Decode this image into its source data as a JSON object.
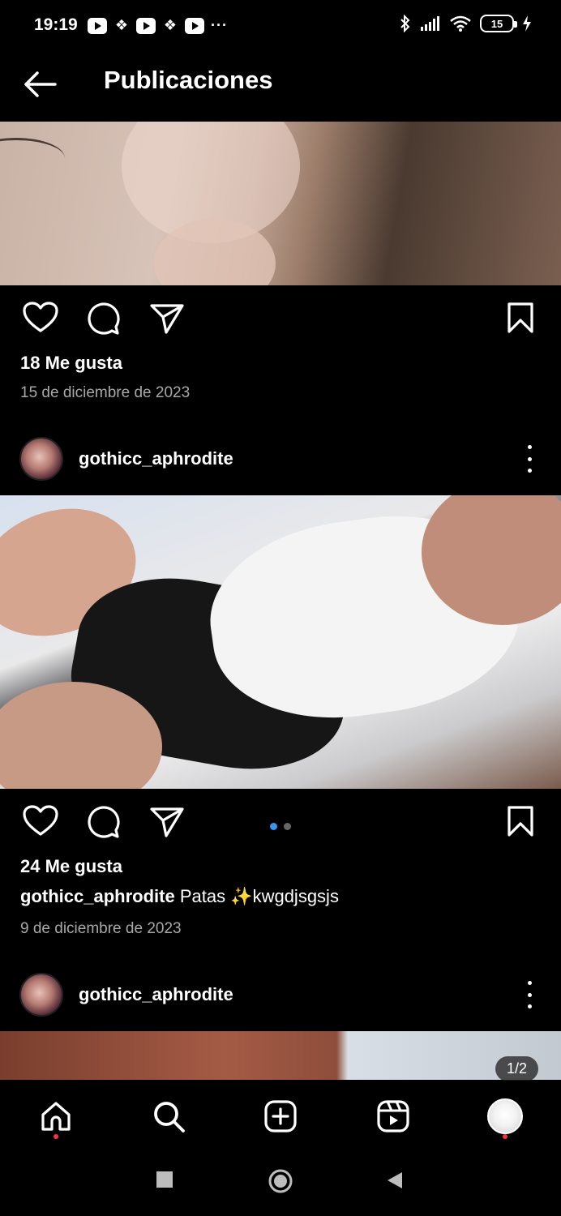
{
  "status_bar": {
    "time": "19:19",
    "notification_icons": [
      "youtube-icon",
      "dropbox-icon",
      "youtube-icon",
      "dropbox-icon",
      "youtube-icon"
    ],
    "more_indicator": "···",
    "battery_level": "15"
  },
  "topbar": {
    "title": "Publicaciones"
  },
  "posts": [
    {
      "likes": "18 Me gusta",
      "date": "15 de diciembre de 2023"
    },
    {
      "username": "gothicc_aphrodite",
      "likes": "24 Me gusta",
      "caption_user": "gothicc_aphrodite",
      "caption_text": "Patas ✨kwgdjsgsjs",
      "date": "9 de diciembre de 2023",
      "carousel_position": 1,
      "carousel_total": 2
    },
    {
      "username": "gothicc_aphrodite",
      "page_counter": "1/2"
    }
  ],
  "bottom_nav": {
    "items": [
      "home-icon",
      "search-icon",
      "create-icon",
      "reels-icon",
      "profile-avatar"
    ]
  },
  "colors": {
    "background": "#000000",
    "secondary_text": "#a8a8a8",
    "carousel_active": "#3897f0",
    "notification_dot": "#ff3040"
  }
}
